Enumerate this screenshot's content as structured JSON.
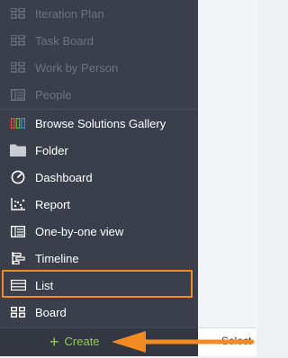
{
  "menu": {
    "disabled_items": [
      {
        "label": "Iteration Plan",
        "icon": "grid-icon"
      },
      {
        "label": "Task Board",
        "icon": "grid-icon"
      },
      {
        "label": "Work by Person",
        "icon": "grid-icon"
      },
      {
        "label": "People",
        "icon": "people-list-icon"
      }
    ],
    "items": [
      {
        "label": "Browse Solutions Gallery",
        "icon": "solutions-gallery-icon"
      },
      {
        "label": "Folder",
        "icon": "folder-icon"
      },
      {
        "label": "Dashboard",
        "icon": "dashboard-icon"
      },
      {
        "label": "Report",
        "icon": "report-icon"
      },
      {
        "label": "One-by-one view",
        "icon": "one-by-one-icon"
      },
      {
        "label": "Timeline",
        "icon": "timeline-icon"
      },
      {
        "label": "List",
        "icon": "list-icon"
      },
      {
        "label": "Board",
        "icon": "board-icon"
      }
    ]
  },
  "footer": {
    "create_label": "Create",
    "select_label": "Select"
  },
  "colors": {
    "panel_bg": "#3a3f4b",
    "highlight": "#f28c22",
    "create_green": "#8fcf4c"
  }
}
